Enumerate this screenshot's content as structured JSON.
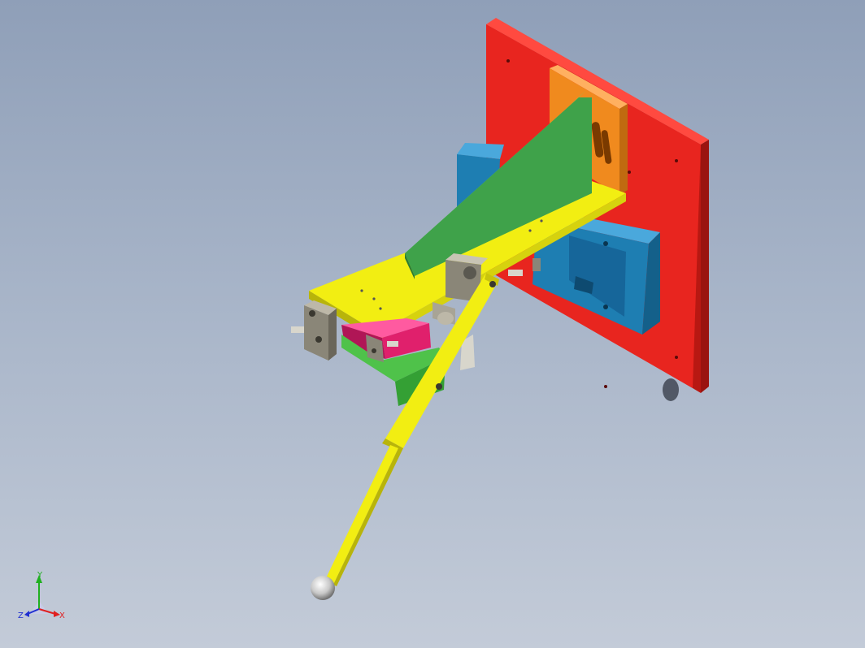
{
  "viewport": {
    "background_top": "#8f9fb8",
    "background_bottom": "#c3cbd8"
  },
  "model": {
    "parts": [
      {
        "name": "mounting-plate",
        "color": "#e8251f"
      },
      {
        "name": "adjust-block",
        "color": "#f08a1e"
      },
      {
        "name": "base-block",
        "color": "#1e7eb2"
      },
      {
        "name": "gusset-plate",
        "color": "#3fa24a"
      },
      {
        "name": "top-bar",
        "color": "#f2ee12"
      },
      {
        "name": "clamp-block",
        "color": "#e0206c"
      },
      {
        "name": "lower-bracket",
        "color": "#4fc24a"
      },
      {
        "name": "handle-lever",
        "color": "#f2ee12"
      },
      {
        "name": "handle-ball",
        "color": "#d8d8d8"
      },
      {
        "name": "pivot-block",
        "color": "#8a8678"
      }
    ]
  },
  "triad": {
    "x_label": "X",
    "y_label": "Y",
    "z_label": "Z",
    "x_color": "#e02020",
    "y_color": "#20b020",
    "z_color": "#2030d0"
  }
}
